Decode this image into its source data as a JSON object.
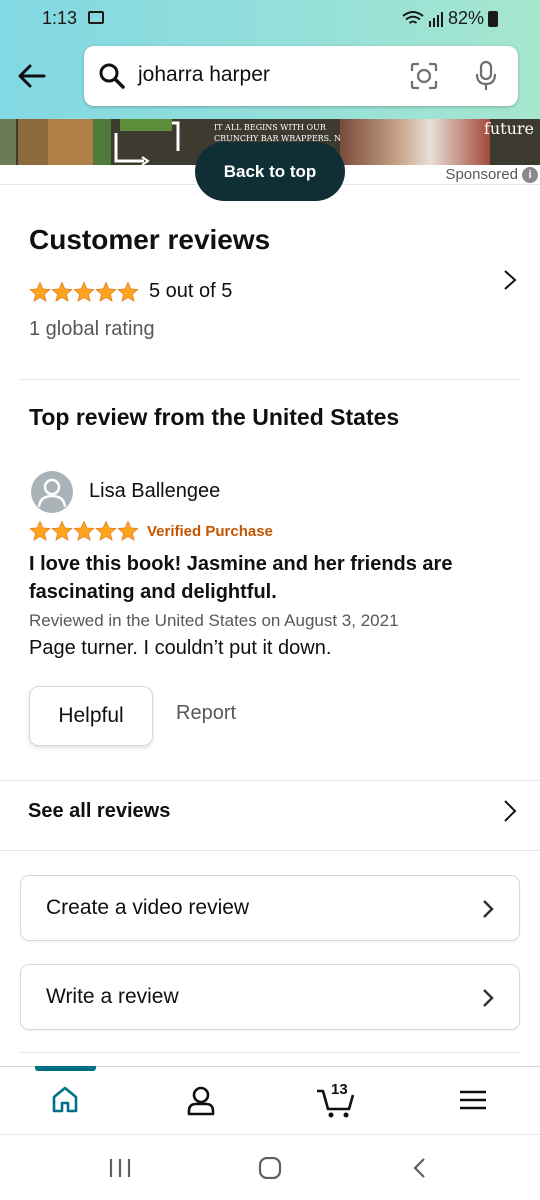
{
  "status_bar": {
    "time": "1:13",
    "battery": "82%"
  },
  "search": {
    "query": "joharra harper"
  },
  "ad": {
    "text_line1": "IT ALL BEGINS WITH OUR",
    "text_line2": "CRUNCHY BAR WRAPPERS. NOW",
    "future": "future",
    "sponsored": "Sponsored",
    "info": "i"
  },
  "back_to_top": "Back to top",
  "reviews": {
    "title": "Customer reviews",
    "rating_text": "5 out of 5",
    "rating_value": 5,
    "global_rating": "1 global rating",
    "top_review_title": "Top review from the United States"
  },
  "review": {
    "reviewer": "Lisa Ballengee",
    "stars": 5,
    "verified": "Verified Purchase",
    "headline": "I love this book! Jasmine and her friends are fascinating and delightful.",
    "date": "Reviewed in the United States on August 3, 2021",
    "body": "Page turner. I couldn’t put it down.",
    "helpful": "Helpful",
    "report": "Report"
  },
  "see_all": "See all reviews",
  "actions": {
    "video": "Create a video review",
    "write": "Write a review"
  },
  "bottom_nav": {
    "cart_count": "13"
  },
  "colors": {
    "star": "#ffa41c",
    "verified": "#c45500",
    "accent": "#007185",
    "back_to_top_bg": "#0f2e35"
  }
}
